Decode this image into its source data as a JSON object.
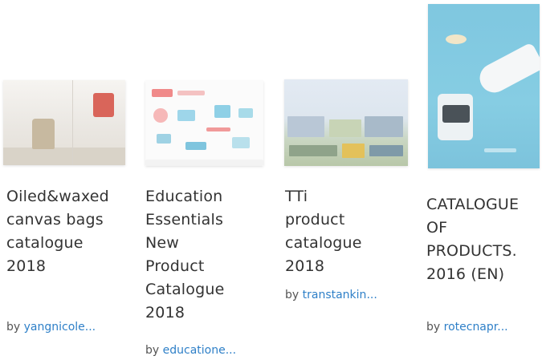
{
  "cards": [
    {
      "title": "Oiled&waxed\ncanvas bags\ncatalogue\n2018",
      "by_prefix": "by",
      "author": "yangnicole",
      "ellipsis": "..."
    },
    {
      "title": "Education\nEssentials\nNew Product\nCatalogue\n2018",
      "by_prefix": "by",
      "author": "educatione",
      "ellipsis": "..."
    },
    {
      "title": "TTi product\ncatalogue\n2018",
      "by_prefix": "by",
      "author": "transtankin",
      "ellipsis": "..."
    },
    {
      "title": "CATALOGUE\nOF\nPRODUCTS.\n2016 (EN)",
      "by_prefix": "by",
      "author": "rotecnapr",
      "ellipsis": "..."
    }
  ],
  "colors": {
    "link": "#2f80c8",
    "text": "#333333"
  }
}
